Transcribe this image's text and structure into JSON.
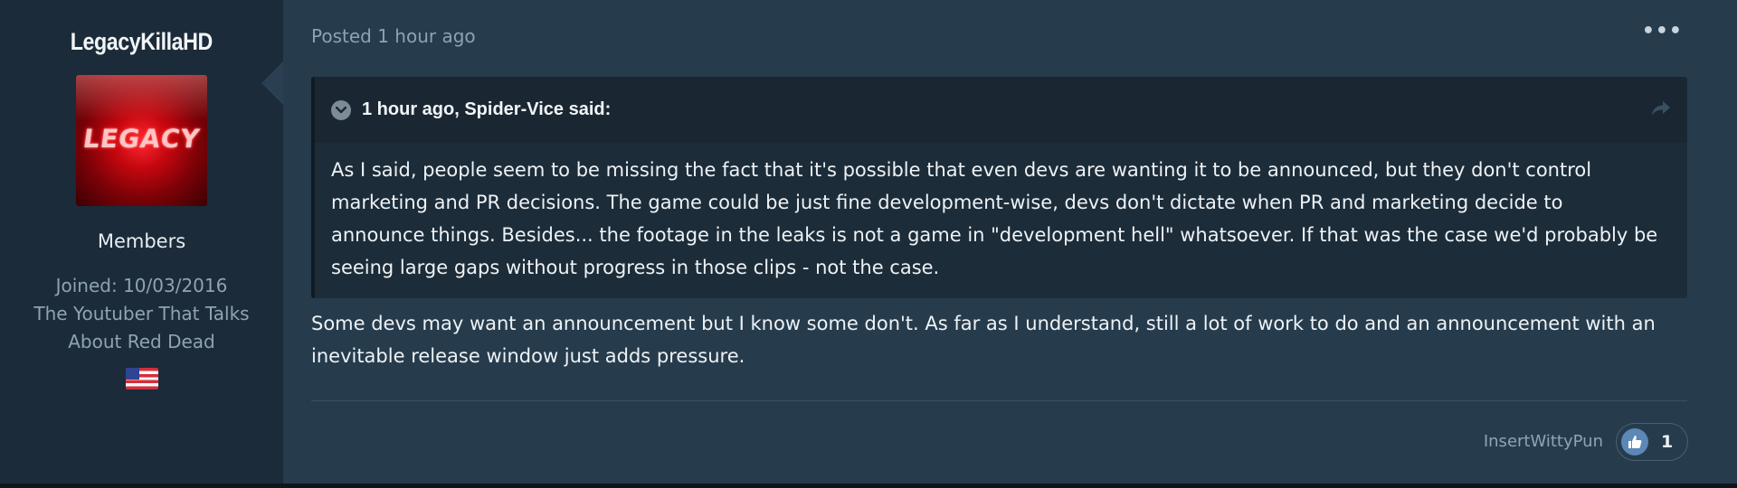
{
  "author": {
    "name": "LegacyKillaHD",
    "avatar_text": "LEGACY",
    "group": "Members",
    "joined": "Joined: 10/03/2016",
    "title_line1": "The Youtuber That Talks",
    "title_line2": "About Red Dead",
    "flag_icon": "us-flag-icon"
  },
  "post": {
    "posted": "Posted 1 hour ago",
    "more_label": "•••",
    "quote": {
      "citation": "1 hour ago, Spider-Vice said:",
      "toggle_icon": "chevron-down-icon",
      "share_icon": "share-arrow-icon",
      "body": "As I said, people seem to be missing the fact that it's possible that even devs are wanting it to be announced, but they don't control marketing and PR decisions. The game could be just fine development-wise, devs don't dictate when PR and marketing decide to announce things. Besides... the footage in the leaks is not a game in \"development hell\" whatsoever. If that was the case we'd probably be seeing large gaps without progress in those clips - not the case."
    },
    "body": "Some devs may want an announcement but I know some don't. As far as I understand, still a lot of work to do and an announcement with an inevitable release window just adds pressure.",
    "reaction": {
      "user": "InsertWittyPun",
      "icon": "thumbs-up-icon",
      "count": "1"
    }
  },
  "colors": {
    "page_bg": "#263c4d",
    "sidebar_bg": "#1b2b39",
    "quote_bg": "#1c2c39",
    "like_blue": "#5b88b5"
  }
}
